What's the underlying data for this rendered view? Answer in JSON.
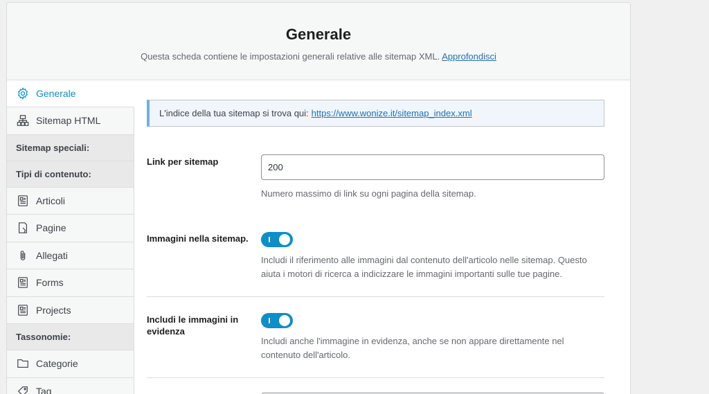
{
  "header": {
    "title": "Generale",
    "subtitle": "Questa scheda contiene le impostazioni generali relative alle sitemap XML.",
    "learn_more": "Approfondisci"
  },
  "sidebar": {
    "generale": "Generale",
    "sitemap_html": "Sitemap HTML",
    "section_special": "Sitemap speciali:",
    "section_content": "Tipi di contenuto:",
    "articoli": "Articoli",
    "pagine": "Pagine",
    "allegati": "Allegati",
    "forms": "Forms",
    "projects": "Projects",
    "section_taxonomies": "Tassonomie:",
    "categorie": "Categorie",
    "tag": "Tag"
  },
  "notice": {
    "text": "L'indice della tua sitemap si trova qui:",
    "link": "https://www.wonize.it/sitemap_index.xml"
  },
  "fields": {
    "links_per_sitemap": {
      "label": "Link per sitemap",
      "value": "200",
      "description": "Numero massimo di link su ogni pagina della sitemap."
    },
    "images_in_sitemap": {
      "label": "Immagini nella sitemap.",
      "enabled": true,
      "description": "Includi il riferimento alle immagini dal contenuto dell'articolo nelle sitemap. Questo aiuta i motori di ricerca a indicizzare le immagini importanti sulle tue pagine."
    },
    "featured_images": {
      "label": "Includi le immagini in evidenza",
      "enabled": true,
      "description": "Includi anche l'immagine in evidenza, anche se non appare direttamente nel contenuto dell'articolo."
    }
  },
  "colors": {
    "accent": "#0d8fc9",
    "link": "#2271b1",
    "notice_border": "#72aee6"
  },
  "icons": {
    "generale": "gear-icon",
    "sitemap_html": "sitemap-icon",
    "articoli": "document-icon",
    "pagine": "page-icon",
    "allegati": "paperclip-icon",
    "forms": "document-icon",
    "projects": "document-icon",
    "categorie": "folder-icon",
    "tag": "tag-icon"
  }
}
